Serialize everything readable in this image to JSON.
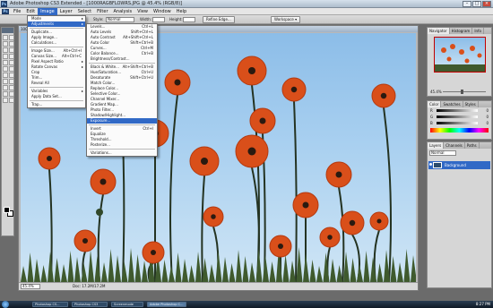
{
  "window": {
    "title": "Adobe Photoshop CS3 Extended - [1000RAGBFLOWRS.JPG @ 45.4% (RGB/8)]"
  },
  "menubar": {
    "items": [
      "File",
      "Edit",
      "Image",
      "Layer",
      "Select",
      "Filter",
      "Analysis",
      "View",
      "Window",
      "Help"
    ],
    "active": "Image"
  },
  "options": {
    "style_label": "Style:",
    "style_value": "Normal",
    "width_label": "Width:",
    "height_label": "Height:",
    "refine_label": "Refine Edge...",
    "workspace_label": "Workspace ▾"
  },
  "image_menu": [
    {
      "label": "Mode",
      "submenu": true
    },
    {
      "label": "Adjustments",
      "submenu": true,
      "highlighted": true
    },
    {
      "sep": true
    },
    {
      "label": "Duplicate..."
    },
    {
      "label": "Apply Image..."
    },
    {
      "label": "Calculations..."
    },
    {
      "sep": true
    },
    {
      "label": "Image Size...",
      "shortcut": "Alt+Ctrl+I"
    },
    {
      "label": "Canvas Size...",
      "shortcut": "Alt+Ctrl+C"
    },
    {
      "label": "Pixel Aspect Ratio",
      "submenu": true
    },
    {
      "label": "Rotate Canvas",
      "submenu": true
    },
    {
      "label": "Crop"
    },
    {
      "label": "Trim..."
    },
    {
      "label": "Reveal All"
    },
    {
      "sep": true
    },
    {
      "label": "Variables",
      "submenu": true
    },
    {
      "label": "Apply Data Set..."
    },
    {
      "sep": true
    },
    {
      "label": "Trap..."
    }
  ],
  "adjustments_menu": [
    {
      "label": "Levels...",
      "shortcut": "Ctrl+L"
    },
    {
      "label": "Auto Levels",
      "shortcut": "Shift+Ctrl+L"
    },
    {
      "label": "Auto Contrast",
      "shortcut": "Alt+Shift+Ctrl+L"
    },
    {
      "label": "Auto Color",
      "shortcut": "Shift+Ctrl+B"
    },
    {
      "label": "Curves...",
      "shortcut": "Ctrl+M"
    },
    {
      "label": "Color Balance...",
      "shortcut": "Ctrl+B"
    },
    {
      "label": "Brightness/Contrast..."
    },
    {
      "sep": true
    },
    {
      "label": "Black & White...",
      "shortcut": "Alt+Shift+Ctrl+B"
    },
    {
      "label": "Hue/Saturation...",
      "shortcut": "Ctrl+U"
    },
    {
      "label": "Desaturate",
      "shortcut": "Shift+Ctrl+U"
    },
    {
      "label": "Match Color..."
    },
    {
      "label": "Replace Color..."
    },
    {
      "label": "Selective Color..."
    },
    {
      "label": "Channel Mixer..."
    },
    {
      "label": "Gradient Map..."
    },
    {
      "label": "Photo Filter..."
    },
    {
      "label": "Shadow/Highlight..."
    },
    {
      "label": "Exposure...",
      "highlighted": true
    },
    {
      "sep": true
    },
    {
      "label": "Invert",
      "shortcut": "Ctrl+I"
    },
    {
      "label": "Equalize"
    },
    {
      "label": "Threshold..."
    },
    {
      "label": "Posterize..."
    },
    {
      "sep": true
    },
    {
      "label": "Variations..."
    }
  ],
  "document": {
    "title": "1000RAGBFLOWRS.JPG @ 45.4% (RGB/8)",
    "zoom": "45.4%",
    "doc_info": "Doc: 17.2M/17.2M"
  },
  "navigator": {
    "tabs": [
      "Navigator",
      "Histogram",
      "Info"
    ],
    "zoom": "45.4%"
  },
  "color_panel": {
    "tabs": [
      "Color",
      "Swatches",
      "Styles"
    ],
    "channels": [
      {
        "name": "R",
        "value": "0"
      },
      {
        "name": "G",
        "value": "0"
      },
      {
        "name": "B",
        "value": "0"
      }
    ]
  },
  "layers_panel": {
    "tabs": [
      "Layers",
      "Channels",
      "Paths"
    ],
    "blend_mode": "Normal",
    "layer_name": "Background"
  },
  "taskbar": {
    "buttons": [
      "Photoshop CS...",
      "Photoshop CS3",
      "Screenmode",
      "Adobe Photoshop C..."
    ],
    "clock": "8:27 PM"
  },
  "colors": {
    "menu_highlight": "#3169c6",
    "poppy": "#d94f1a",
    "sky": "#a9d0f0"
  }
}
